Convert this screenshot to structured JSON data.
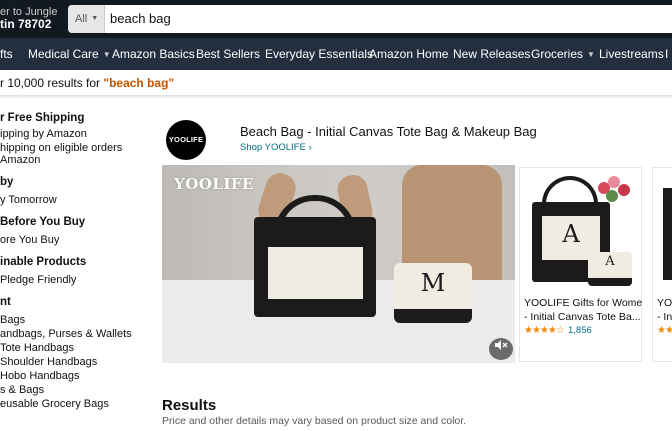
{
  "header": {
    "deliver_line1": "er to Jungle",
    "deliver_line2": "tin 78702",
    "search_category": "All",
    "search_value": "beach bag"
  },
  "nav": {
    "items": [
      {
        "label": "fts",
        "dropdown": false
      },
      {
        "label": "Medical Care",
        "dropdown": true
      },
      {
        "label": "Amazon Basics",
        "dropdown": false
      },
      {
        "label": "Best Sellers",
        "dropdown": false
      },
      {
        "label": "Everyday Essentials",
        "dropdown": false
      },
      {
        "label": "Amazon Home",
        "dropdown": false
      },
      {
        "label": "New Releases",
        "dropdown": false
      },
      {
        "label": "Groceries",
        "dropdown": true
      },
      {
        "label": "Livestreams",
        "dropdown": false
      },
      {
        "label": "I",
        "dropdown": false
      }
    ]
  },
  "results_bar": {
    "prefix": "r 10,000 results for ",
    "query": "\"beach bag\""
  },
  "sidebar": {
    "lines": [
      {
        "text": "r Free Shipping",
        "heading": true
      },
      {
        "text": "ipping by Amazon",
        "heading": false
      },
      {
        "text": "hipping on eligible orders",
        "heading": false
      },
      {
        "text": "Amazon",
        "heading": false
      },
      {
        "text": "by",
        "heading": true
      },
      {
        "text": "y Tomorrow",
        "heading": false
      },
      {
        "text": "Before You Buy",
        "heading": true
      },
      {
        "text": "ore You Buy",
        "heading": false
      },
      {
        "text": "inable Products",
        "heading": true
      },
      {
        "text": "Pledge Friendly",
        "heading": false
      },
      {
        "text": "nt",
        "heading": true
      },
      {
        "text": "Bags",
        "heading": false
      },
      {
        "text": "andbags, Purses & Wallets",
        "heading": false
      },
      {
        "text": "Tote Handbags",
        "heading": false
      },
      {
        "text": "Shoulder Handbags",
        "heading": false
      },
      {
        "text": "Hobo Handbags",
        "heading": false
      },
      {
        "text": "s & Bags",
        "heading": false
      },
      {
        "text": "eusable Grocery Bags",
        "heading": false
      }
    ]
  },
  "sponsored": {
    "logo_text": "YOOLIFE",
    "title": "Beach Bag - Initial Canvas Tote Bag & Makeup Bag",
    "shop_link": "Shop YOOLIFE ›",
    "video_watermark": "YOOLIFE",
    "bag_letter": "M",
    "mute_icon": "mute-icon"
  },
  "products": [
    {
      "title_line1": "YOOLIFE Gifts for Women",
      "title_line2": "- Initial Canvas Tote Ba...",
      "stars": "★★★★☆",
      "rating_count": "1,856",
      "letter": "A"
    },
    {
      "title_line1": "YO",
      "title_line2": "- In",
      "stars": "★★",
      "rating_count": "",
      "letter": ""
    }
  ],
  "results": {
    "title": "Results",
    "subtitle": "Price and other details may vary based on product size and color."
  }
}
